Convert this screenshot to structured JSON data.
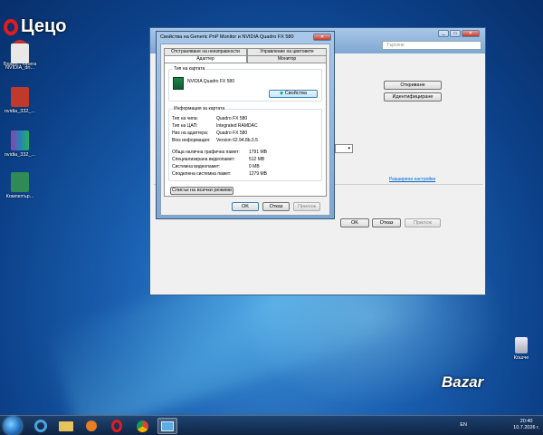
{
  "desktop": {
    "brand_text": "Цецо",
    "icons": [
      {
        "label": "Брауз... Opera",
        "color": "#c9302c"
      },
      {
        "label": "NVIDIA_dri...",
        "color": "#e8e8e8"
      },
      {
        "label": "nvidia_332_...",
        "color": "#c0392b"
      },
      {
        "label": "nvidia_332_...",
        "color": "#8e44ad"
      },
      {
        "label": "Компютър...",
        "color": "#2e8b57"
      }
    ],
    "recycle_bin_label": "Кошче",
    "watermark": "Bazar"
  },
  "back_window": {
    "search_placeholder": "Търсене",
    "buttons": {
      "detect": "Откриване",
      "identify": "Идентифициране",
      "ok": "OK",
      "cancel": "Отказ",
      "apply": "Прилож"
    },
    "advanced_link": "Разширени настройки"
  },
  "dialog": {
    "title": "Свойства на Generic PnP Monitor и NVIDIA Quadro FX 580",
    "tabs_top": [
      "Отстраняване на неизправности",
      "Управление на цветовете"
    ],
    "tabs_bottom": [
      "Адаптер",
      "Монитор"
    ],
    "card_type_group": "Тип на картата",
    "card_name": "NVIDIA Quadro FX 580",
    "properties_button": "Свойства",
    "info_group": "Информация за картата",
    "info_rows": [
      {
        "label": "Тип на чипа:",
        "value": "Quadro FX 580"
      },
      {
        "label": "Тип на ЦАП:",
        "value": "Integrated RAMDAC"
      },
      {
        "label": "Низ на адаптера:",
        "value": "Quadro FX 580"
      },
      {
        "label": "Bios информация:",
        "value": "Version 62.94.8b.0.5"
      }
    ],
    "mem_rows": [
      {
        "label": "Обща налична графична памет:",
        "value": "1791 MB"
      },
      {
        "label": "Специализирана видеопамет:",
        "value": "512 MB"
      },
      {
        "label": "Системна видеопамет:",
        "value": "0 MB"
      },
      {
        "label": "Споделена системна памет:",
        "value": "1279 MB"
      }
    ],
    "list_modes_button": "Списък на всички режими",
    "ok": "OK",
    "cancel": "Отказ",
    "apply": "Прилож"
  },
  "taskbar": {
    "lang": "EN",
    "time": "20:40",
    "date": "10.7.2026 г."
  }
}
